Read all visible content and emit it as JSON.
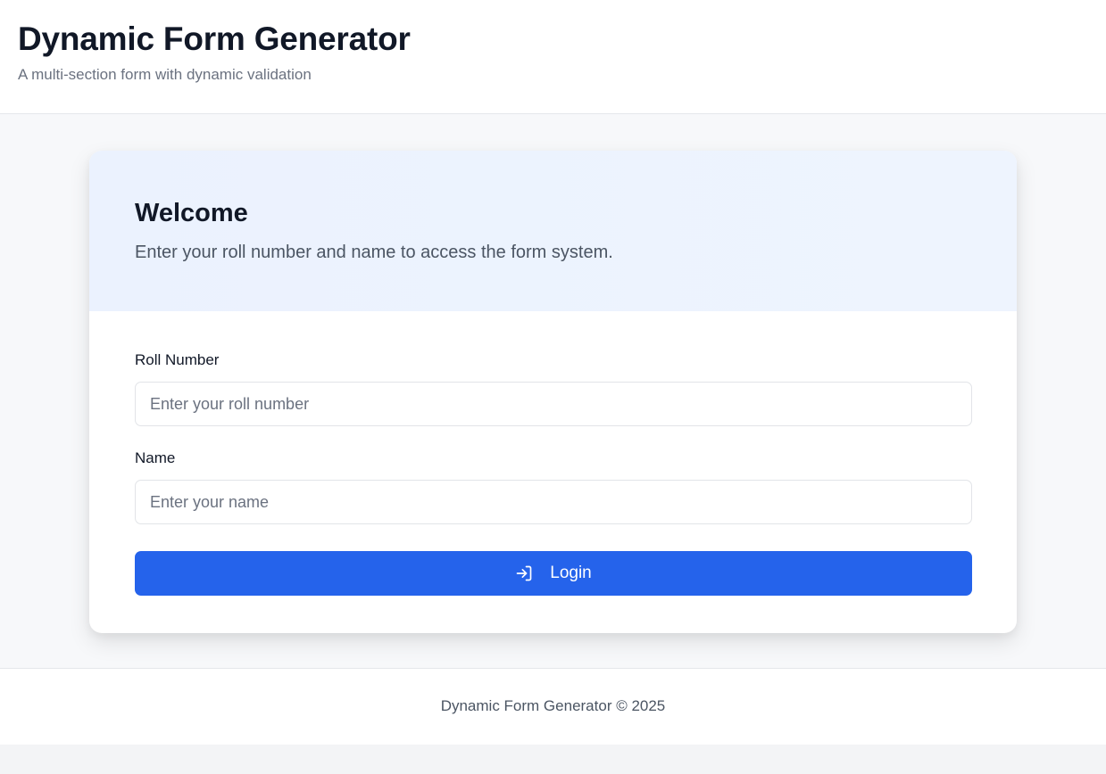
{
  "header": {
    "title": "Dynamic Form Generator",
    "subtitle": "A multi-section form with dynamic validation"
  },
  "card": {
    "title": "Welcome",
    "description": "Enter your roll number and name to access the form system."
  },
  "form": {
    "roll_number": {
      "label": "Roll Number",
      "value": "",
      "placeholder": "Enter your roll number"
    },
    "name": {
      "label": "Name",
      "value": "",
      "placeholder": "Enter your name"
    },
    "login_label": "Login",
    "login_icon": "login-icon"
  },
  "footer": {
    "text": "Dynamic Form Generator © 2025"
  },
  "colors": {
    "accent": "#2563eb",
    "card_header_bg": "#eef4fe",
    "page_bg": "#f3f4f6"
  }
}
